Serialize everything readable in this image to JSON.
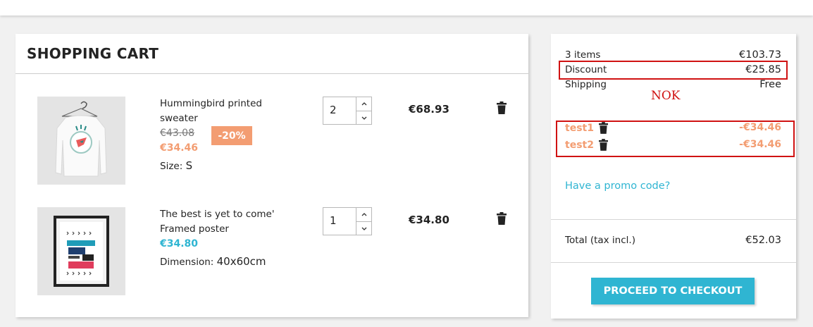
{
  "cart": {
    "title": "SHOPPING CART",
    "items": [
      {
        "name": "Hummingbird printed sweater",
        "regular_price": "€43.08",
        "discount_badge": "-20%",
        "price": "€34.46",
        "attr_label": "Size:",
        "attr_value": "S",
        "quantity": "2",
        "total": "€68.93",
        "thumbnail": "sweater-image"
      },
      {
        "name": "The best is yet to come' Framed poster",
        "price": "€34.80",
        "attr_label": "Dimension:",
        "attr_value": "40x60cm",
        "quantity": "1",
        "total": "€34.80",
        "thumbnail": "poster-image"
      }
    ]
  },
  "summary": {
    "items_label": "3 items",
    "items_value": "€103.73",
    "discount_label": "Discount",
    "discount_value": "€25.85",
    "shipping_label": "Shipping",
    "shipping_value": "Free",
    "vouchers": [
      {
        "name": "test1",
        "amount": "-€34.46"
      },
      {
        "name": "test2",
        "amount": "-€34.46"
      }
    ],
    "promo_link": "Have a promo code?",
    "total_label": "Total (tax incl.)",
    "total_value": "€52.03",
    "checkout_label": "PROCEED TO CHECKOUT"
  },
  "annotation": {
    "text": "NOK",
    "color": "#d01212"
  },
  "colors": {
    "accent": "#2fb5d2",
    "discount": "#f39d72"
  }
}
